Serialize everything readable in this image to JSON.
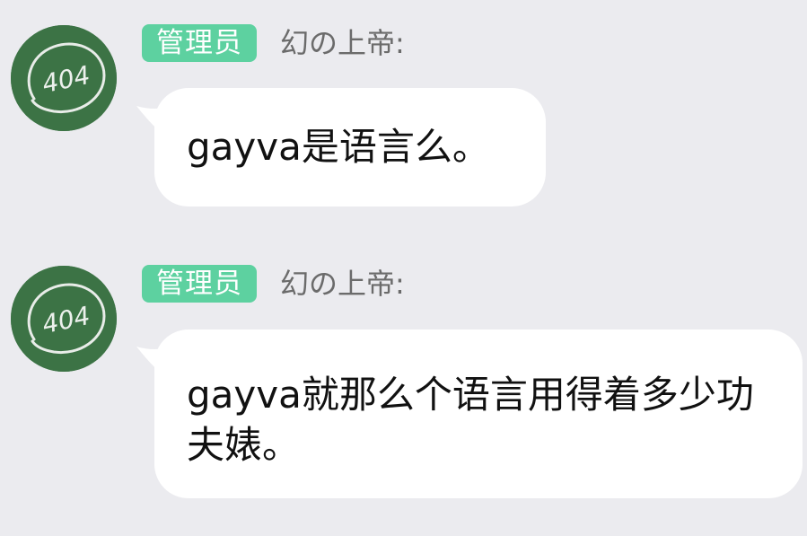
{
  "messages": [
    {
      "avatar_text": "404",
      "role_badge": "管理员",
      "username": "幻の上帝:",
      "text": "gayva是语言么。"
    },
    {
      "avatar_text": "404",
      "role_badge": "管理员",
      "username": "幻の上帝:",
      "text": "gayva就那么个语言用得着多少功夫婊。"
    }
  ],
  "colors": {
    "background": "#ebebef",
    "bubble": "#ffffff",
    "badge": "#5dd1a0",
    "avatar": "#3c7345",
    "username": "#6b6b6b"
  }
}
